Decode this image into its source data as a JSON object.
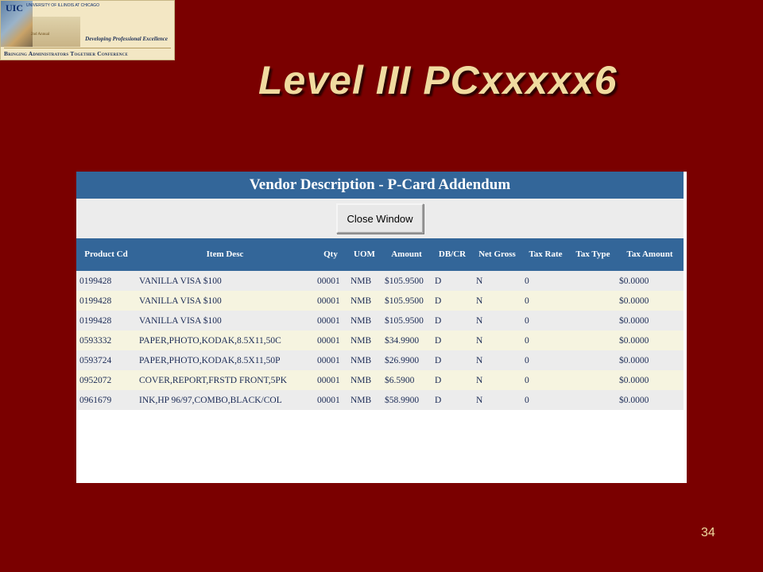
{
  "slide_title": "Level III PCxxxxx6",
  "page_number": "34",
  "logo": {
    "uic": "UIC",
    "uic_sub": "UNIVERSITY OF ILLINOIS AT CHICAGO",
    "annual": "2nd Annual",
    "tagline": "Developing Professional Excellence",
    "conference": "Bringing Administrators Together Conference"
  },
  "window": {
    "title": "Vendor Description - P-Card Addendum",
    "close_button": "Close Window"
  },
  "table": {
    "headers": [
      "Product Cd",
      "Item Desc",
      "Qty",
      "UOM",
      "Amount",
      "DB/CR",
      "Net Gross",
      "Tax Rate",
      "Tax Type",
      "Tax Amount"
    ],
    "rows": [
      [
        "0199428",
        "VANILLA VISA $100",
        "00001",
        "NMB",
        "$105.9500",
        "D",
        "N",
        "0",
        "",
        "$0.0000"
      ],
      [
        "0199428",
        "VANILLA VISA $100",
        "00001",
        "NMB",
        "$105.9500",
        "D",
        "N",
        "0",
        "",
        "$0.0000"
      ],
      [
        "0199428",
        "VANILLA VISA $100",
        "00001",
        "NMB",
        "$105.9500",
        "D",
        "N",
        "0",
        "",
        "$0.0000"
      ],
      [
        "0593332",
        "PAPER,PHOTO,KODAK,8.5X11,50C",
        "00001",
        "NMB",
        "$34.9900",
        "D",
        "N",
        "0",
        "",
        "$0.0000"
      ],
      [
        "0593724",
        "PAPER,PHOTO,KODAK,8.5X11,50P",
        "00001",
        "NMB",
        "$26.9900",
        "D",
        "N",
        "0",
        "",
        "$0.0000"
      ],
      [
        "0952072",
        "COVER,REPORT,FRSTD FRONT,5PK",
        "00001",
        "NMB",
        "$6.5900",
        "D",
        "N",
        "0",
        "",
        "$0.0000"
      ],
      [
        "0961679",
        "INK,HP 96/97,COMBO,BLACK/COL",
        "00001",
        "NMB",
        "$58.9900",
        "D",
        "N",
        "0",
        "",
        "$0.0000"
      ]
    ]
  }
}
